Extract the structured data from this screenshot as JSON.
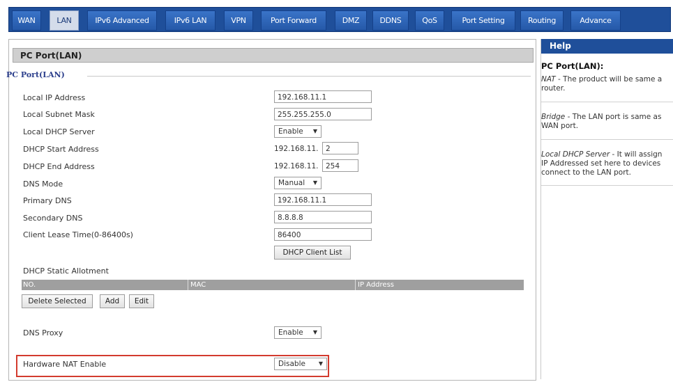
{
  "tabs": [
    {
      "label": "WAN"
    },
    {
      "label": "LAN",
      "active": true
    },
    {
      "label": "IPv6 Advanced"
    },
    {
      "label": "IPv6 LAN"
    },
    {
      "label": "VPN"
    },
    {
      "label": "Port Forward"
    },
    {
      "label": "DMZ"
    },
    {
      "label": "DDNS"
    },
    {
      "label": "QoS"
    },
    {
      "label": "Port Setting"
    },
    {
      "label": "Routing"
    },
    {
      "label": "Advance"
    }
  ],
  "page_title": "PC Port(LAN)",
  "section_legend": "PC Port(LAN)",
  "form": {
    "local_ip_label": "Local IP Address",
    "local_ip_value": "192.168.11.1",
    "subnet_label": "Local Subnet Mask",
    "subnet_value": "255.255.255.0",
    "dhcp_server_label": "Local DHCP Server",
    "dhcp_server_value": "Enable",
    "dhcp_start_label": "DHCP Start Address",
    "dhcp_start_prefix": "192.168.11.",
    "dhcp_start_value": "2",
    "dhcp_end_label": "DHCP End Address",
    "dhcp_end_prefix": "192.168.11.",
    "dhcp_end_value": "254",
    "dns_mode_label": "DNS Mode",
    "dns_mode_value": "Manual",
    "primary_dns_label": "Primary DNS",
    "primary_dns_value": "192.168.11.1",
    "secondary_dns_label": "Secondary DNS",
    "secondary_dns_value": "8.8.8.8",
    "lease_label": "Client Lease Time(0-86400s)",
    "lease_value": "86400",
    "client_list_button": "DHCP Client List",
    "static_allotment_label": "DHCP Static Allotment",
    "static_columns": [
      "NO.",
      "MAC",
      "IP Address"
    ],
    "delete_button": "Delete Selected",
    "add_button": "Add",
    "edit_button": "Edit",
    "dns_proxy_label": "DNS Proxy",
    "dns_proxy_value": "Enable",
    "hw_nat_label": "Hardware NAT Enable",
    "hw_nat_value": "Disable"
  },
  "help": {
    "title": "Help",
    "heading": "PC Port(LAN):",
    "nat_term": "NAT",
    "nat_text": " - The product will be same a",
    "nat_text2": "router.",
    "bridge_term": "Bridge",
    "bridge_text": " - The LAN port is same as",
    "bridge_text2": "WAN port.",
    "dhcp_term": "Local DHCP Server",
    "dhcp_text": " - It will assign",
    "dhcp_text2": "IP Addressed set here to devices",
    "dhcp_text3": "connect to the LAN port."
  },
  "dropdown_arrow": "▼",
  "colors": {
    "tab_bg": "#1f4f9a",
    "highlight": "#d33b2e",
    "header_gray": "#cfcfcf"
  }
}
